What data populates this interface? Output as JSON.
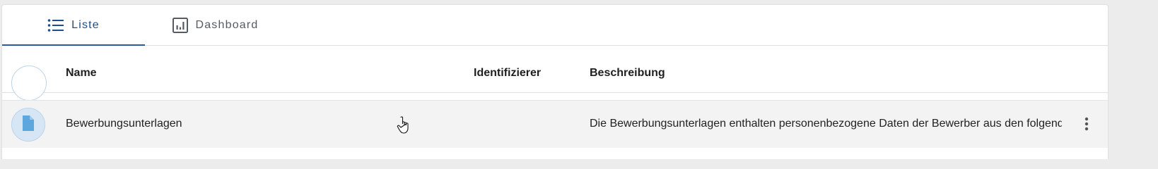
{
  "tabs": [
    {
      "label": "Liste",
      "icon": "list-icon",
      "active": true
    },
    {
      "label": "Dashboard",
      "icon": "dashboard-icon",
      "active": false
    }
  ],
  "table": {
    "columns": [
      "Name",
      "Identifizierer",
      "Beschreibung"
    ],
    "rows": [
      {
        "icon": "document-icon",
        "name": "Bewerbungsunterlagen",
        "identifier": "",
        "description": "Die Bewerbungsunterlagen enthalten personenbezogene Daten der Bewerber aus den folgenden Quellen"
      }
    ]
  },
  "colors": {
    "accent": "#1f4e8c",
    "row_hover": "#f3f3f3",
    "avatar_bg": "#d6e6f5",
    "icon_blue": "#5ea7de"
  }
}
